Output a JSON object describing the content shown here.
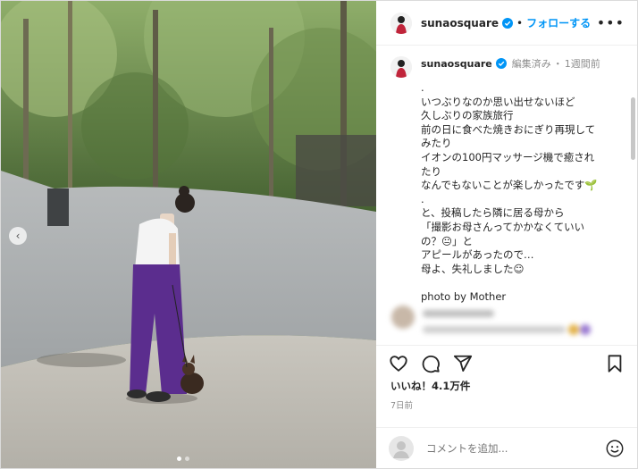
{
  "post": {
    "username": "sunaosquare",
    "follow_label": "フォローする",
    "separator": "•",
    "more_label": "•••",
    "edited_label": "編集済み",
    "meta_dot": "・",
    "time_ago": "1週間前",
    "caption": ".\nいつぶりなのか思い出せないほど\n久しぶりの家族旅行\n前の日に食べた焼きおにぎり再現して\nみたり\nイオンの100円マッサージ機で癒され\nたり\nなんでもないことが楽しかったです🌱\n.\nと、投稿したら隣に居る母から\n「撮影お母さんってかかなくていい\nの？😐」と\nアピールがあったので…\n母よ、失礼しました☺\n\nphoto by Mother",
    "likes": "いいね！4.1万件",
    "date": "7日前",
    "comment_placeholder": "コメントを追加...",
    "carousel": {
      "total": 2,
      "active_index": 0
    }
  },
  "icons": {
    "verified": "verified-badge-icon",
    "like": "heart-icon",
    "comment": "comment-icon",
    "share": "share-icon",
    "save": "bookmark-icon",
    "emoji": "smiley-icon",
    "carousel_prev": "chevron-left-icon"
  },
  "colors": {
    "accent": "#0095f6",
    "text": "#262626",
    "muted": "#8e8e8e",
    "pants": "#5b2d8e"
  }
}
